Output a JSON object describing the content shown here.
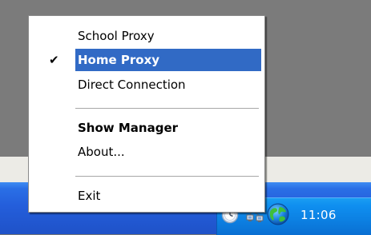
{
  "context_menu": {
    "items": [
      {
        "label": "School Proxy",
        "checked": false,
        "bold": false,
        "highlighted": false
      },
      {
        "label": "Home Proxy",
        "checked": true,
        "bold": true,
        "highlighted": true
      },
      {
        "label": "Direct Connection",
        "checked": false,
        "bold": false,
        "highlighted": false
      },
      {
        "label": "Show Manager",
        "checked": false,
        "bold": true,
        "highlighted": false
      },
      {
        "label": "About...",
        "checked": false,
        "bold": false,
        "highlighted": false
      },
      {
        "label": "Exit",
        "checked": false,
        "bold": false,
        "highlighted": false
      }
    ],
    "check_glyph": "✔",
    "highlight_color": "#316ac5"
  },
  "system_tray": {
    "clock": "11:06",
    "icons": [
      "clock-tray-icon",
      "network-connection-icon",
      "globe-proxy-icon"
    ]
  },
  "taskbar": {
    "color": "#245edb"
  }
}
